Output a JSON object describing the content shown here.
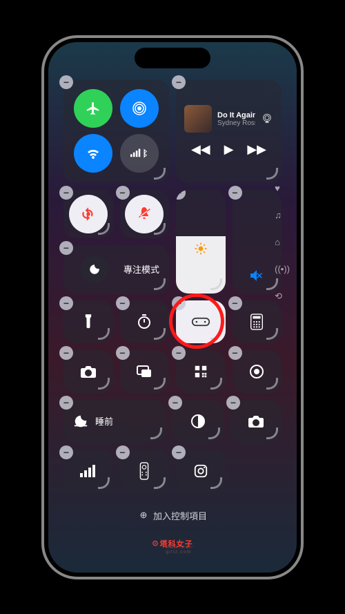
{
  "media": {
    "title": "Do It Again",
    "artist": "Sydney Ross Mitch"
  },
  "focus": {
    "label": "專注模式"
  },
  "sleep": {
    "label": "睡前"
  },
  "add_control": "加入控制項目",
  "watermark": {
    "brand": "塔科女子",
    "url": "www.tech-girlz.com"
  },
  "icons": {
    "airplane": "airplane-icon",
    "airdrop": "airdrop-icon",
    "wifi": "wifi-icon",
    "cellular": "cellular-icon",
    "bluetooth": "bluetooth-icon",
    "rotation_lock": "rotation-lock-icon",
    "silent": "silent-bell-icon",
    "moon": "moon-icon",
    "brightness": "sun-icon",
    "volume_mute": "speaker-mute-icon",
    "flashlight": "flashlight-icon",
    "timer": "timer-icon",
    "controller": "game-controller-icon",
    "calculator": "calculator-icon",
    "camera": "camera-icon",
    "mirror": "screen-mirroring-icon",
    "qrcode": "qr-scanner-icon",
    "record": "screen-record-icon",
    "sleep_moon": "bed-moon-icon",
    "contrast": "contrast-icon",
    "camera2": "camera-icon",
    "signal": "cellular-bars-icon",
    "remote": "remote-icon",
    "instagram": "social-icon"
  },
  "side": {
    "heart": "favorites-icon",
    "music": "music-icon",
    "home": "home-icon",
    "broadcast": "broadcast-icon",
    "loop": "loop-icon"
  }
}
